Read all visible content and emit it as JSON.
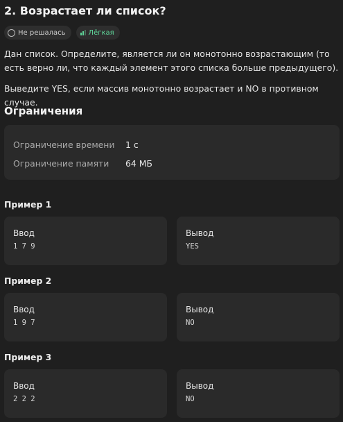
{
  "problem": {
    "title": "2. Возрастает ли список?",
    "status_label": "Не решалась",
    "difficulty_label": "Лёгкая",
    "statement": "Дан список. Определите, является ли он монотонно возрастающим (то есть верно ли, что каждый элемент этого списка больше предыдущего).",
    "output_spec": "Выведите YES, если массив монотонно возрастает и NO в противном случае."
  },
  "limits": {
    "heading": "Ограничения",
    "rows": [
      {
        "label": "Ограничение времени",
        "value": "1 с"
      },
      {
        "label": "Ограничение памяти",
        "value": "64 МБ"
      }
    ]
  },
  "examples": [
    {
      "title": "Пример 1",
      "input_label": "Ввод",
      "input": "1 7 9",
      "output_label": "Вывод",
      "output": "YES"
    },
    {
      "title": "Пример 2",
      "input_label": "Ввод",
      "input": "1 9 7",
      "output_label": "Вывод",
      "output": "NO"
    },
    {
      "title": "Пример 3",
      "input_label": "Ввод",
      "input": "2 2 2",
      "output_label": "Вывод",
      "output": "NO"
    }
  ],
  "colors": {
    "background": "#1f1f1f",
    "card": "#2a2a2a",
    "easy_accent": "#5fd69a"
  }
}
